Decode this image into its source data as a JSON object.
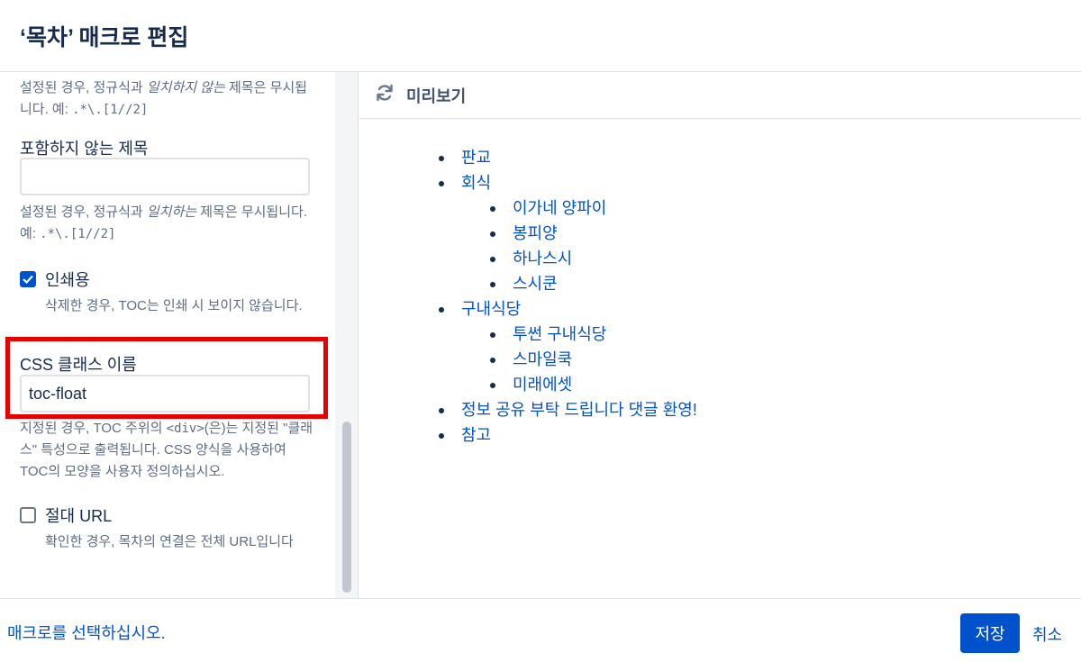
{
  "dialog": {
    "title": "‘목차’ 매크로 편집"
  },
  "left": {
    "desc1": {
      "pre": "설정된 경우, 정규식과 ",
      "em": "일치하지 않는",
      "post": " 제목은 무시됩니다. 예: ",
      "code": ".*\\.[1//2]"
    },
    "exclude": {
      "label": "포함하지 않는 제목",
      "value": "",
      "desc": {
        "pre": "설정된 경우, 정규식과 ",
        "em": "일치하는",
        "post": " 제목은 무시됩니다. 예: ",
        "code": ".*\\.[1//2]"
      }
    },
    "printable": {
      "label": "인쇄용",
      "checked": true,
      "desc": "삭제한 경우, TOC는 인쇄 시 보이지 않습니다."
    },
    "css_class": {
      "label": "CSS 클래스 이름",
      "value": "toc-float",
      "desc": {
        "pre": "지정된 경우, TOC 주위의 ",
        "code": "<div>",
        "post": "(은)는 지정된 \"클래스\" 특성으로 출력됩니다. CSS 양식을 사용하여 TOC의 모양을 사용자 정의하십시오."
      }
    },
    "absolute_url": {
      "label": "절대 URL",
      "checked": false,
      "desc": "확인한 경우, 목차의 연결은 전체 URL입니다"
    }
  },
  "preview": {
    "title": "미리보기",
    "refresh_icon": "refresh-icon",
    "items": [
      {
        "label": "판교",
        "level": 1
      },
      {
        "label": "회식",
        "level": 1
      },
      {
        "label": "이가네 양파이",
        "level": 2
      },
      {
        "label": "봉피양",
        "level": 2
      },
      {
        "label": "하나스시",
        "level": 2
      },
      {
        "label": "스시쿤",
        "level": 2
      },
      {
        "label": "구내식당",
        "level": 1
      },
      {
        "label": "투썬 구내식당",
        "level": 2
      },
      {
        "label": "스마일쿡",
        "level": 2
      },
      {
        "label": "미래에셋",
        "level": 2
      },
      {
        "label": "정보 공유 부탁 드립니다 댓글 환영!",
        "level": 1
      },
      {
        "label": "참고",
        "level": 1
      }
    ]
  },
  "footer": {
    "select_macro_link": "매크로를 선택하십시오.",
    "save_label": "저장",
    "cancel_label": "취소"
  },
  "colors": {
    "accent": "#0052cc",
    "highlight": "#e60000",
    "text": "#172b4d",
    "muted": "#5e6c84"
  }
}
